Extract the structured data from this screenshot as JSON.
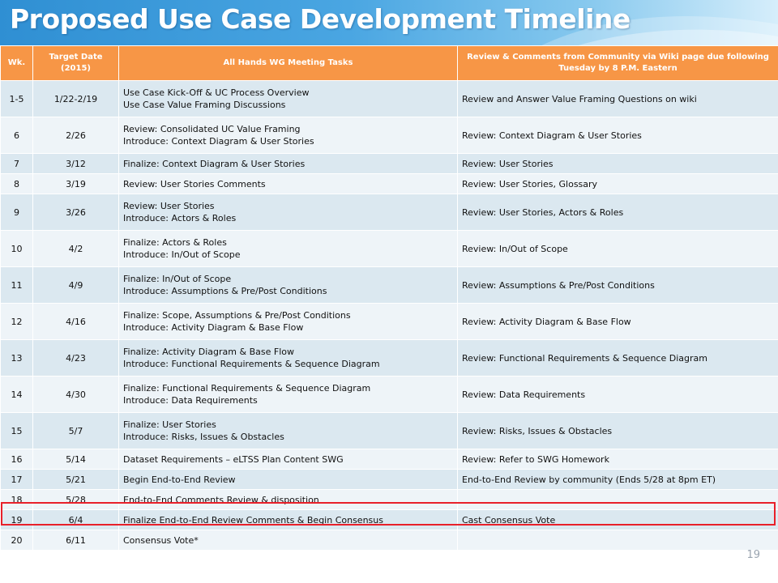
{
  "title": "Proposed Use Case Development Timeline",
  "page_number": "19",
  "colors": {
    "header_bg": "#f79646",
    "banner": "#2f8fd3",
    "highlight": "#e8202a"
  },
  "headers": {
    "wk": "Wk.",
    "date": "Target Date (2015)",
    "tasks": "All Hands WG Meeting Tasks",
    "review": "Review & Comments from Community via Wiki page due following Tuesday by 8 P.M. Eastern"
  },
  "rows": [
    {
      "wk": "1-5",
      "date": "1/22-2/19",
      "tasks": [
        "Use Case Kick-Off & UC Process Overview",
        "Use Case Value Framing Discussions"
      ],
      "review": "Review and Answer Value Framing Questions on wiki"
    },
    {
      "wk": "6",
      "date": "2/26",
      "tasks": [
        "Review: Consolidated UC Value Framing",
        "Introduce: Context Diagram & User Stories"
      ],
      "review": "Review:  Context Diagram & User Stories"
    },
    {
      "wk": "7",
      "date": "3/12",
      "tasks": [
        "Finalize: Context Diagram & User Stories"
      ],
      "review": "Review: User Stories"
    },
    {
      "wk": "8",
      "date": "3/19",
      "tasks": [
        "Review: User Stories Comments"
      ],
      "review": "Review:  User Stories, Glossary"
    },
    {
      "wk": "9",
      "date": "3/26",
      "tasks": [
        "Review: User Stories",
        "Introduce: Actors & Roles"
      ],
      "review": "Review: User Stories, Actors & Roles"
    },
    {
      "wk": "10",
      "date": "4/2",
      "tasks": [
        "Finalize: Actors & Roles",
        "Introduce: In/Out of Scope"
      ],
      "review": "Review: In/Out of Scope"
    },
    {
      "wk": "11",
      "date": "4/9",
      "tasks": [
        "Finalize: In/Out of Scope",
        "Introduce: Assumptions & Pre/Post Conditions"
      ],
      "review": "Review: Assumptions & Pre/Post Conditions"
    },
    {
      "wk": "12",
      "date": "4/16",
      "tasks": [
        "Finalize: Scope, Assumptions & Pre/Post Conditions",
        "Introduce: Activity Diagram & Base Flow"
      ],
      "review": "Review: Activity Diagram & Base Flow"
    },
    {
      "wk": "13",
      "date": "4/23",
      "tasks": [
        "Finalize: Activity Diagram & Base Flow",
        "Introduce: Functional  Requirements & Sequence Diagram"
      ],
      "review": "Review: Functional Requirements & Sequence Diagram"
    },
    {
      "wk": "14",
      "date": "4/30",
      "tasks": [
        "Finalize: Functional Requirements & Sequence Diagram",
        "Introduce: Data Requirements"
      ],
      "review": "Review: Data Requirements"
    },
    {
      "wk": "15",
      "date": "5/7",
      "tasks": [
        "Finalize: User Stories",
        "Introduce: Risks, Issues & Obstacles"
      ],
      "review": "Review: Risks, Issues & Obstacles"
    },
    {
      "wk": "16",
      "date": "5/14",
      "tasks": [
        "Dataset Requirements – eLTSS Plan Content SWG"
      ],
      "review": "Review: Refer to SWG Homework"
    },
    {
      "wk": "17",
      "date": "5/21",
      "tasks": [
        "Begin End-to-End Review"
      ],
      "review": "End-to-End Review by community (Ends 5/28 at 8pm ET)"
    },
    {
      "wk": "18",
      "date": "5/28",
      "tasks": [
        "End-to-End Comments Review & disposition"
      ],
      "review": ""
    },
    {
      "wk": "19",
      "date": "6/4",
      "tasks": [
        "Finalize End-to-End Review Comments & Begin Consensus"
      ],
      "review": "Cast Consensus Vote"
    },
    {
      "wk": "20",
      "date": "6/11",
      "tasks": [
        "Consensus Vote*"
      ],
      "review": ""
    }
  ]
}
